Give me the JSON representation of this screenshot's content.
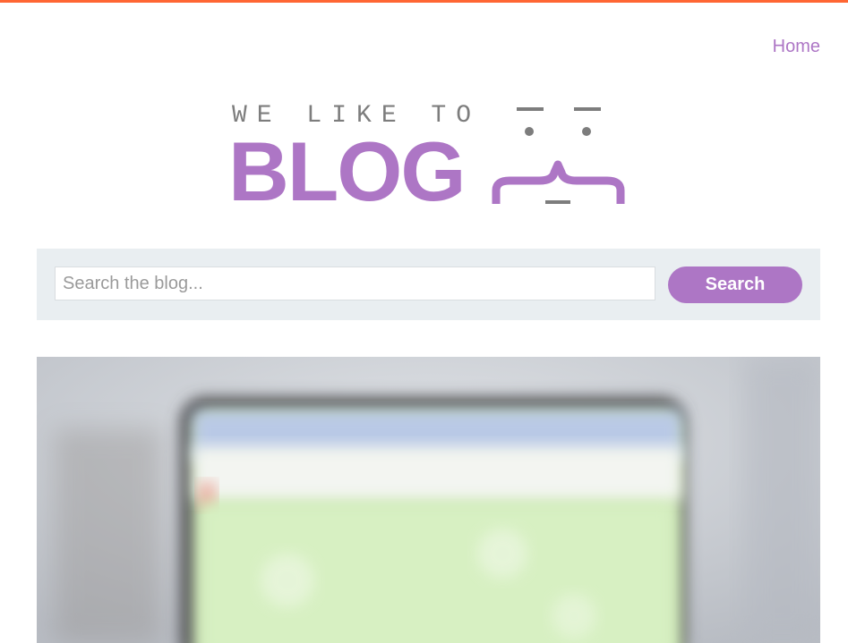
{
  "nav": {
    "home_label": "Home"
  },
  "logo": {
    "tagline": "WE LIKE TO",
    "word": "BLOG"
  },
  "search": {
    "placeholder": "Search the blog...",
    "value": "",
    "button_label": "Search"
  },
  "colors": {
    "accent": "#ad76c5",
    "top_bar": "#ff6633",
    "panel": "#e9eef1",
    "logo_grey": "#7d7d7d"
  },
  "hero": {
    "icon": "blurred-tv-image"
  }
}
